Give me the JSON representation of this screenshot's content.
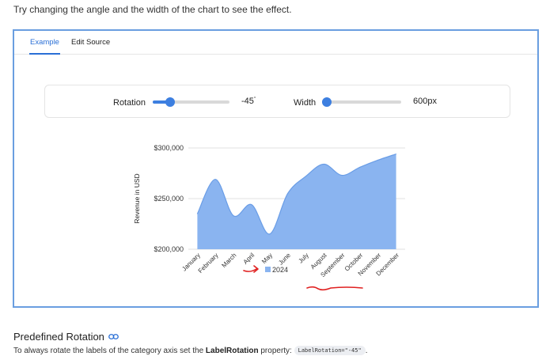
{
  "intro_text": "Try changing the angle and the width of the chart to see the effect.",
  "tabs": {
    "example": "Example",
    "edit_source": "Edit Source"
  },
  "controls": {
    "rotation_label": "Rotation",
    "rotation_value": "-45",
    "rotation_unit": "°",
    "rotation_fraction": 0.23,
    "width_label": "Width",
    "width_value": "600px",
    "width_fraction": 0.06
  },
  "colors": {
    "accent": "#3d7fe0",
    "area_fill": "#8ab4f0",
    "area_stroke": "#6a9de6",
    "annotation": "#e02020"
  },
  "chart_data": {
    "type": "area",
    "categories": [
      "January",
      "February",
      "March",
      "April",
      "May",
      "June",
      "July",
      "August",
      "September",
      "October",
      "November",
      "December"
    ],
    "series": [
      {
        "name": "2024",
        "values": [
          235000,
          269000,
          233000,
          244000,
          215000,
          255000,
          272000,
          284000,
          273000,
          281000,
          288000,
          294000
        ]
      }
    ],
    "ylabel": "Revenue in USD",
    "yticks": [
      "$200,000",
      "$250,000",
      "$300,000"
    ],
    "ylim": [
      200000,
      300000
    ],
    "x_label_rotation": -45,
    "legend_position": "bottom",
    "grid": true
  },
  "section": {
    "title": "Predefined Rotation",
    "desc_before": "To always rotate the labels of the category axis set the ",
    "desc_bold": "LabelRotation",
    "desc_after": " property: ",
    "code": "LabelRotation=\"-45\"",
    "desc_end": "."
  }
}
